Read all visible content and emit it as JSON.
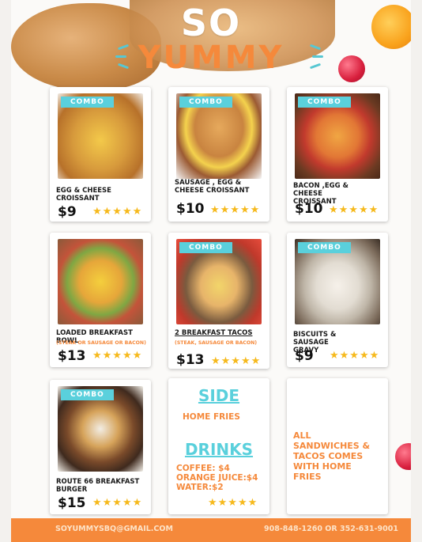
{
  "header": {
    "title_top": "SO",
    "title_bottom": "YUMMY"
  },
  "colors": {
    "accent_orange": "#f5893b",
    "accent_teal": "#5ad0dc",
    "star": "#f6b91c"
  },
  "items": [
    {
      "combo": "COMBO",
      "name": "EGG & CHEESE CROISSANT",
      "sub": "",
      "price": "$9",
      "stars": "★★★★★"
    },
    {
      "combo": "COMBO",
      "name": "SAUSAGE , EGG & CHEESE CROISSANT",
      "sub": "",
      "price": "$10",
      "stars": "★★★★★"
    },
    {
      "combo": "COMBO",
      "name": "BACON ,EGG & CHEESE CROISSANT",
      "sub": "",
      "price": "$10",
      "stars": "★★★★★"
    },
    {
      "combo": "",
      "name": "LOADED BREAKFAST BOWL",
      "sub": "(STEAK OR SAUSAGE OR BACON)",
      "price": "$13",
      "stars": "★★★★★"
    },
    {
      "combo": "COMBO",
      "name": "2 BREAKFAST TACOS",
      "sub": "(STEAK, SAUSAGE OR BACON)",
      "price": "$13",
      "stars": "★★★★★"
    },
    {
      "combo": "COMBO",
      "name": "BISCUITS & SAUSAGE GRAVY",
      "sub": "",
      "price": "$9",
      "stars": "★★★★★"
    },
    {
      "combo": "COMBO",
      "name": "ROUTE 66 BREAKFAST BURGER",
      "sub": "",
      "price": "$15",
      "stars": "★★★★★"
    }
  ],
  "sides": {
    "side_title": "SIDE",
    "side_item": "HOME FRIES",
    "drinks_title": "DRINKS",
    "drinks": [
      "COFFEE: $4",
      "ORANGE JUICE:$4",
      "WATER:$2"
    ],
    "stars": "★★★★★"
  },
  "note": {
    "text": "ALL SANDWICHES & TACOS COMES WITH HOME FRIES"
  },
  "footer": {
    "email": "SOYUMMYSBQ@GMAIL.COM",
    "phone": "908-848-1260 OR 352-631-9001"
  }
}
